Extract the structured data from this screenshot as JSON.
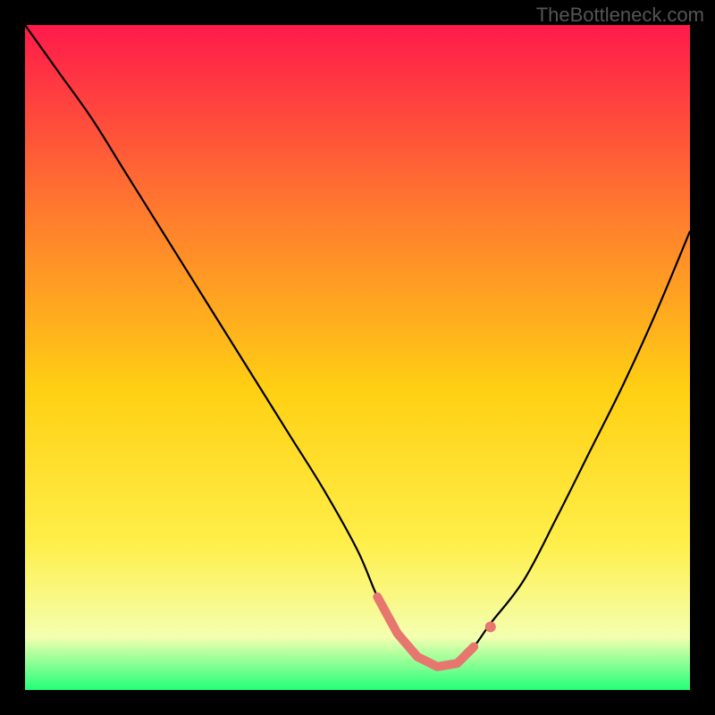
{
  "watermark": "TheBottleneck.com",
  "chart_data": {
    "type": "line",
    "title": "",
    "xlabel": "",
    "ylabel": "",
    "x": [
      0.0,
      0.05,
      0.1,
      0.15,
      0.2,
      0.25,
      0.3,
      0.35,
      0.4,
      0.45,
      0.5,
      0.53,
      0.56,
      0.59,
      0.62,
      0.65,
      0.675,
      0.7,
      0.75,
      0.8,
      0.85,
      0.9,
      0.95,
      1.0
    ],
    "y": [
      1.0,
      0.93,
      0.86,
      0.78,
      0.7,
      0.62,
      0.54,
      0.46,
      0.38,
      0.3,
      0.21,
      0.14,
      0.085,
      0.05,
      0.035,
      0.04,
      0.065,
      0.1,
      0.165,
      0.26,
      0.36,
      0.46,
      0.57,
      0.69
    ],
    "xlim": [
      0,
      1
    ],
    "ylim": [
      0,
      1
    ],
    "gradient_colors": {
      "top": "#ff1a4b",
      "mid_upper": "#ff7a2e",
      "mid": "#ffd013",
      "mid_lower": "#ffef4a",
      "lower": "#f4ffb0",
      "bottom": "#23ff79"
    },
    "highlight": {
      "color": "#e7766f",
      "x": [
        0.53,
        0.56,
        0.59,
        0.62,
        0.65,
        0.675
      ],
      "y": [
        0.14,
        0.085,
        0.05,
        0.035,
        0.04,
        0.065
      ]
    },
    "bump": {
      "x": 0.7,
      "y": 0.095,
      "color": "#e7766f"
    }
  }
}
